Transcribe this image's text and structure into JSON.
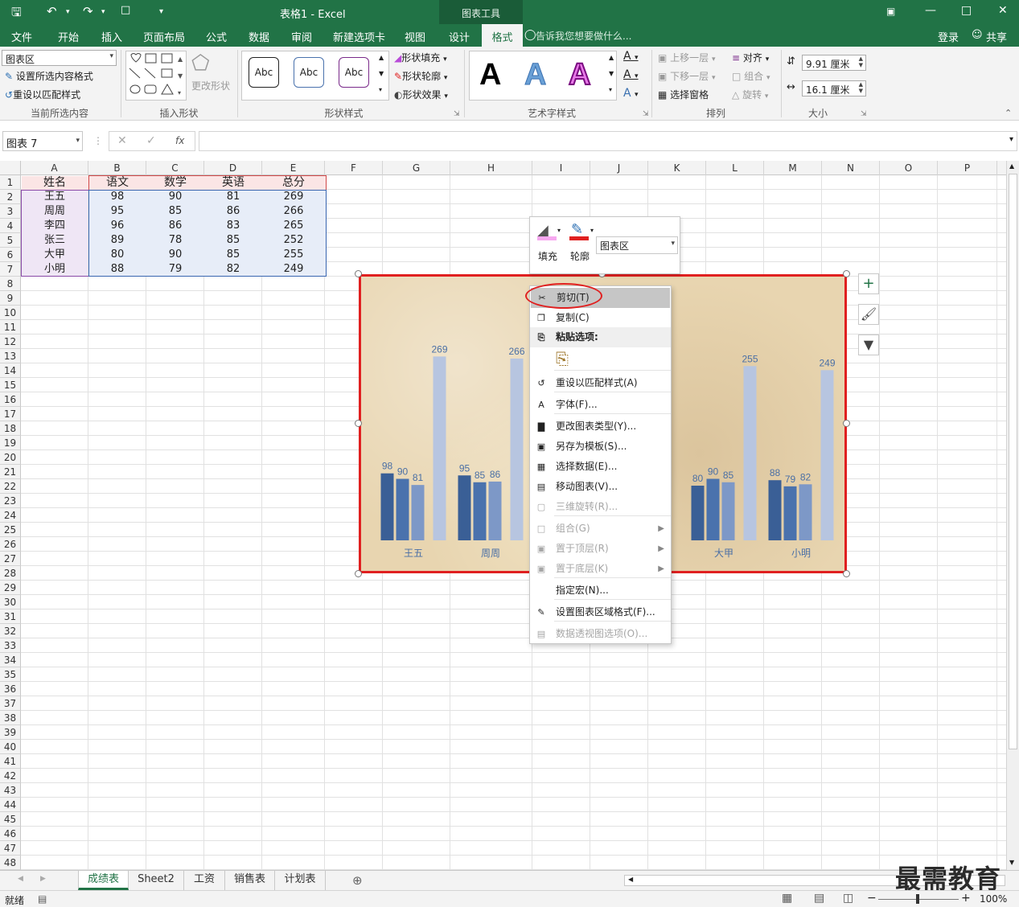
{
  "window": {
    "title": "表格1 - Excel",
    "context_tab_group": "图表工具",
    "login": "登录",
    "share": "共享"
  },
  "tabs": [
    "文件",
    "开始",
    "插入",
    "页面布局",
    "公式",
    "数据",
    "审阅",
    "新建选项卡",
    "视图",
    "设计",
    "格式"
  ],
  "active_tab": "格式",
  "tell_me": "告诉我您想要做什么...",
  "ribbon": {
    "current_selection": {
      "combo_value": "图表区",
      "format_selection": "设置所选内容格式",
      "reset_style": "重设以匹配样式",
      "label": "当前所选内容"
    },
    "insert_shapes": {
      "change_shape": "更改形状",
      "label": "插入形状"
    },
    "shape_styles": {
      "preset_text": "Abc",
      "fill": "形状填充",
      "outline": "形状轮廓",
      "effects": "形状效果",
      "label": "形状样式"
    },
    "wordart": {
      "glyph": "A",
      "label": "艺术字样式"
    },
    "arrange": {
      "bring_forward": "上移一层",
      "send_backward": "下移一层",
      "selection_pane": "选择窗格",
      "align": "对齐",
      "group": "组合",
      "rotate": "旋转",
      "label": "排列"
    },
    "size": {
      "height": "9.91 厘米",
      "width": "16.1 厘米",
      "label": "大小"
    }
  },
  "formula_bar": {
    "name_box": "图表 7",
    "fx": "fx",
    "value": ""
  },
  "columns": [
    "A",
    "B",
    "C",
    "D",
    "E",
    "F",
    "G",
    "H",
    "I",
    "J",
    "K",
    "L",
    "M",
    "N",
    "O",
    "P"
  ],
  "row_count": 48,
  "table": {
    "headers": [
      "姓名",
      "语文",
      "数学",
      "英语",
      "总分"
    ],
    "rows": [
      [
        "王五",
        "98",
        "90",
        "81",
        "269"
      ],
      [
        "周周",
        "95",
        "85",
        "86",
        "266"
      ],
      [
        "李四",
        "96",
        "86",
        "83",
        "265"
      ],
      [
        "张三",
        "89",
        "78",
        "85",
        "252"
      ],
      [
        "大甲",
        "80",
        "90",
        "85",
        "255"
      ],
      [
        "小明",
        "88",
        "79",
        "82",
        "249"
      ]
    ]
  },
  "chart_data": {
    "type": "bar",
    "categories": [
      "王五",
      "周周",
      "李四",
      "张三",
      "大甲",
      "小明"
    ],
    "series": [
      {
        "values": [
          98,
          95,
          96,
          89,
          80,
          88
        ],
        "color": "#3a5f96"
      },
      {
        "values": [
          90,
          85,
          86,
          78,
          90,
          79
        ],
        "color": "#4a72ad"
      },
      {
        "values": [
          81,
          86,
          83,
          85,
          85,
          82
        ],
        "color": "#7d98c7"
      },
      {
        "values": [
          269,
          266,
          265,
          252,
          255,
          249
        ],
        "color": "#b7c5e0"
      }
    ],
    "visible_categories": [
      "王五",
      "周周",
      "大甲",
      "小明"
    ],
    "ylim": [
      0,
      300
    ],
    "data_labels": true,
    "label_color": "#4a6fa5",
    "border_color": "#e02020"
  },
  "mini_toolbar": {
    "fill": "填充",
    "outline": "轮廓",
    "element": "图表区"
  },
  "context_menu": [
    {
      "label": "剪切(T)",
      "icon": "scissors-icon",
      "enabled": true,
      "highlight": true
    },
    {
      "label": "复制(C)",
      "icon": "copy-icon",
      "enabled": true
    },
    {
      "label": "粘贴选项:",
      "icon": "paste-icon",
      "enabled": true,
      "header": true
    },
    {
      "label": "重设以匹配样式(A)",
      "icon": "reset-style-icon",
      "enabled": true
    },
    {
      "label": "字体(F)...",
      "icon": "font-icon",
      "enabled": true
    },
    {
      "label": "更改图表类型(Y)...",
      "icon": "chart-type-icon",
      "enabled": true
    },
    {
      "label": "另存为模板(S)...",
      "icon": "save-template-icon",
      "enabled": true
    },
    {
      "label": "选择数据(E)...",
      "icon": "select-data-icon",
      "enabled": true
    },
    {
      "label": "移动图表(V)...",
      "icon": "move-chart-icon",
      "enabled": true
    },
    {
      "label": "三维旋转(R)...",
      "icon": "3d-rotate-icon",
      "enabled": false
    },
    {
      "label": "组合(G)",
      "icon": "group-icon",
      "enabled": false,
      "submenu": true
    },
    {
      "label": "置于顶层(R)",
      "icon": "bring-front-icon",
      "enabled": false,
      "submenu": true
    },
    {
      "label": "置于底层(K)",
      "icon": "send-back-icon",
      "enabled": false,
      "submenu": true
    },
    {
      "label": "指定宏(N)...",
      "icon": "",
      "enabled": true
    },
    {
      "label": "设置图表区域格式(F)...",
      "icon": "format-area-icon",
      "enabled": true
    },
    {
      "label": "数据透视图选项(O)...",
      "icon": "pivot-icon",
      "enabled": false
    }
  ],
  "sheets": [
    "成绩表",
    "Sheet2",
    "工资",
    "销售表",
    "计划表"
  ],
  "active_sheet": "成绩表",
  "status": {
    "ready": "就绪",
    "zoom": "100%"
  },
  "watermark": "最需教育"
}
